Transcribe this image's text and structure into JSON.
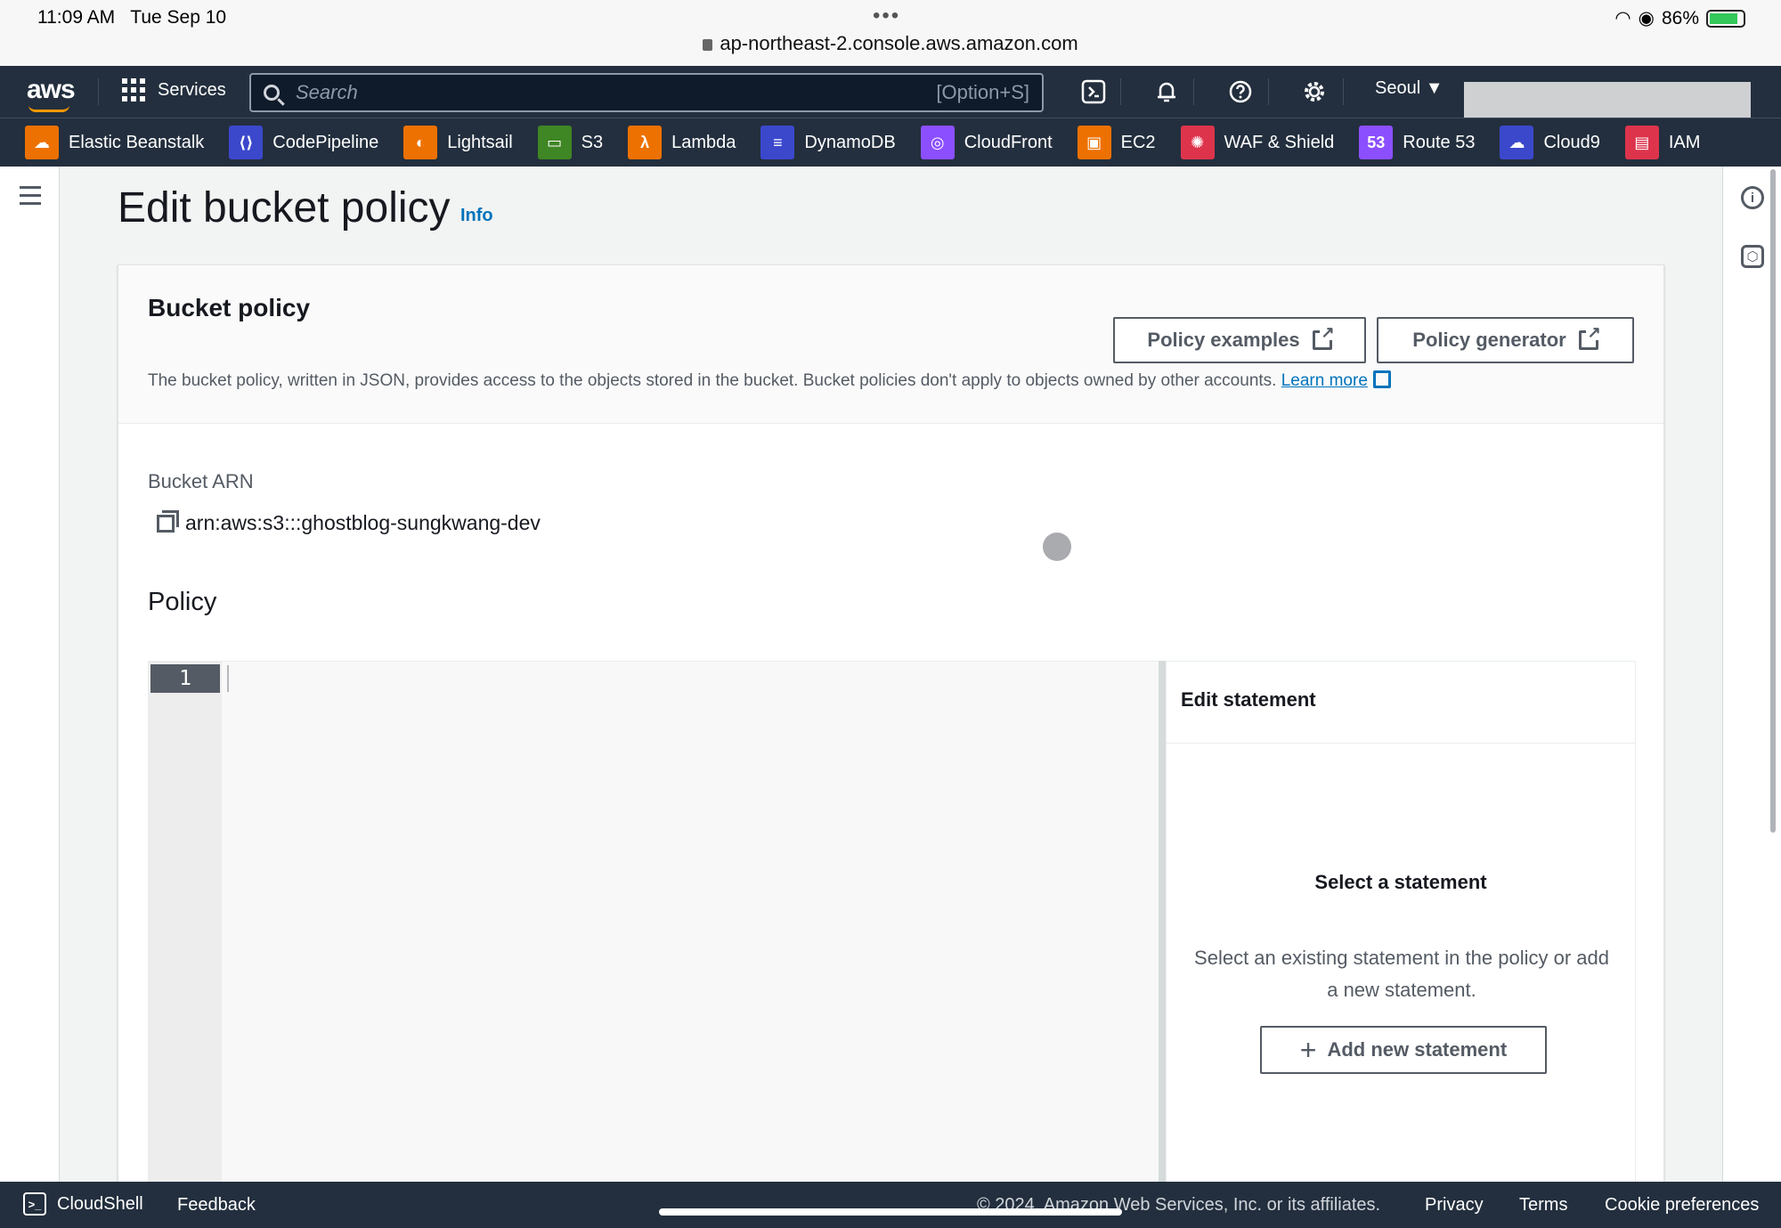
{
  "status_bar": {
    "time": "11:09 AM",
    "date": "Tue Sep 10",
    "url": "ap-northeast-2.console.aws.amazon.com",
    "battery": "86%",
    "battery_level": 0.86
  },
  "topnav": {
    "logo": "aws",
    "services_label": "Services",
    "search_placeholder": "Search",
    "search_shortcut": "[Option+S]",
    "region": "Seoul"
  },
  "favorites": [
    {
      "label": "Elastic Beanstalk",
      "color": "#ed7100",
      "icon": "beanstalk-icon"
    },
    {
      "label": "CodePipeline",
      "color": "#3b48cc",
      "icon": "codepipeline-icon"
    },
    {
      "label": "Lightsail",
      "color": "#ed7100",
      "icon": "lightsail-icon"
    },
    {
      "label": "S3",
      "color": "#3f8624",
      "icon": "s3-icon"
    },
    {
      "label": "Lambda",
      "color": "#ed7100",
      "icon": "lambda-icon"
    },
    {
      "label": "DynamoDB",
      "color": "#3b48cc",
      "icon": "dynamodb-icon"
    },
    {
      "label": "CloudFront",
      "color": "#8c4fff",
      "icon": "cloudfront-icon"
    },
    {
      "label": "EC2",
      "color": "#ed7100",
      "icon": "ec2-icon"
    },
    {
      "label": "WAF & Shield",
      "color": "#dd344c",
      "icon": "waf-icon"
    },
    {
      "label": "Route 53",
      "color": "#8c4fff",
      "icon": "route53-icon"
    },
    {
      "label": "Cloud9",
      "color": "#3b48cc",
      "icon": "cloud9-icon"
    },
    {
      "label": "IAM",
      "color": "#dd344c",
      "icon": "iam-icon"
    }
  ],
  "page": {
    "title": "Edit bucket policy",
    "info": "Info"
  },
  "bucket_policy": {
    "title": "Bucket policy",
    "policy_examples": "Policy examples",
    "policy_generator": "Policy generator",
    "description": "The bucket policy, written in JSON, provides access to the objects stored in the bucket. Bucket policies don't apply to objects owned by other accounts.",
    "learn_more": "Learn more",
    "arn_label": "Bucket ARN",
    "arn_value": "arn:aws:s3:::ghostblog-sungkwang-dev",
    "policy_label": "Policy",
    "line_number": "1"
  },
  "edit_statement": {
    "title": "Edit statement",
    "empty_title": "Select a statement",
    "empty_desc": "Select an existing statement in the policy or add a new statement.",
    "add_button": "Add new statement"
  },
  "footer": {
    "cloudshell": "CloudShell",
    "feedback": "Feedback",
    "copyright": "© 2024, Amazon Web Services, Inc. or its affiliates.",
    "privacy": "Privacy",
    "terms": "Terms",
    "cookie": "Cookie preferences"
  }
}
